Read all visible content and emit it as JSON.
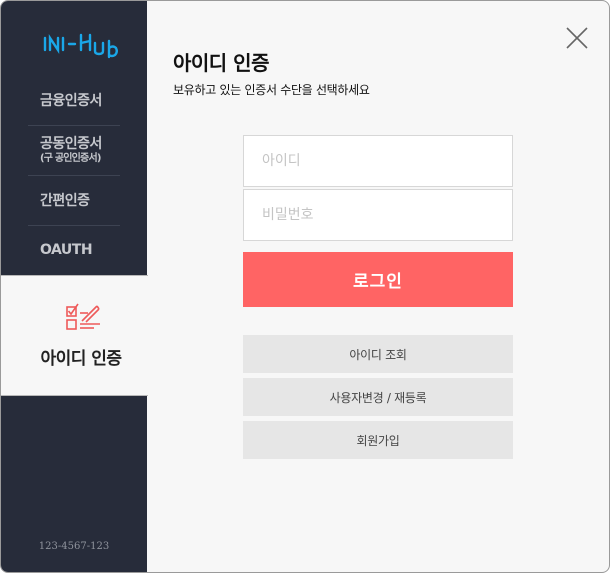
{
  "sidebar": {
    "logo": "INI-HUB",
    "items": [
      {
        "label": "금융인증서"
      },
      {
        "label": "공동인증서",
        "sub": "(구 공인인증서)"
      },
      {
        "label": "간편인증"
      },
      {
        "label": "OAUTH"
      }
    ],
    "active": {
      "label": "아이디 인증",
      "icon": "id-auth-icon"
    },
    "phone": "123-4567-123"
  },
  "main": {
    "title": "아이디 인증",
    "subtitle": "보유하고 있는 인증서 수단을 선택하세요",
    "id_placeholder": "아이디",
    "pw_placeholder": "비밀번호",
    "login_label": "로그인",
    "links": [
      "아이디 조회",
      "사용자변경 / 재등록",
      "회원가입"
    ]
  },
  "colors": {
    "sidebar_bg": "#272c3a",
    "accent": "#ff6464",
    "logo_blue": "#1aa7e8"
  }
}
